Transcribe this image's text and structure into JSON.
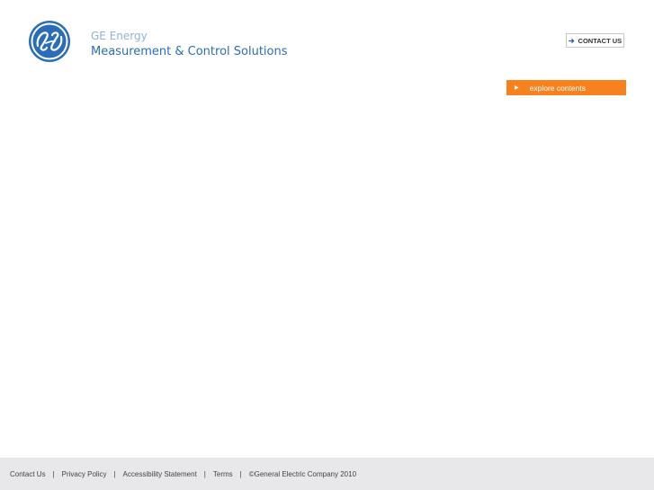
{
  "header": {
    "logo_icon": "ge-monogram-icon",
    "brand_line1": "GE Energy",
    "brand_line2": "Measurement & Control Solutions",
    "contact_label": "CONTACT US",
    "contact_icon": "arrow-right-icon"
  },
  "explore": {
    "label": "explore contents",
    "icon": "triangle-right-icon",
    "color": "#f5821f"
  },
  "footer": {
    "links": {
      "contact": "Contact Us",
      "privacy": "Privacy Policy",
      "accessibility": "Accessibility Statement",
      "terms": "Terms"
    },
    "separator": "|",
    "copyright": "©General Electric Company 2010"
  },
  "colors": {
    "ge_blue": "#2b6db8",
    "brand_light": "#8fb3d9",
    "footer_bg": "#e8e8ea"
  }
}
